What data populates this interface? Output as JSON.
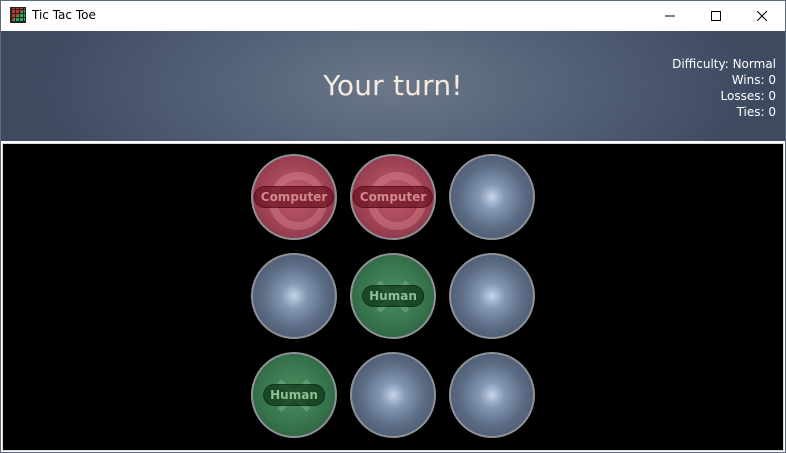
{
  "window": {
    "title": "Tic Tac Toe"
  },
  "header": {
    "turn_message": "Your turn!",
    "stats": {
      "difficulty": "Difficulty: Normal",
      "wins": "Wins: 0",
      "losses": "Losses: 0",
      "ties": "Ties: 0"
    }
  },
  "board": {
    "owner_labels": {
      "computer": "Computer",
      "human": "Human"
    },
    "cells": [
      {
        "state": "computer",
        "label": "Computer"
      },
      {
        "state": "computer",
        "label": "Computer"
      },
      {
        "state": "empty",
        "label": ""
      },
      {
        "state": "empty",
        "label": ""
      },
      {
        "state": "human",
        "label": "Human"
      },
      {
        "state": "empty",
        "label": ""
      },
      {
        "state": "human",
        "label": "Human"
      },
      {
        "state": "empty",
        "label": ""
      },
      {
        "state": "empty",
        "label": ""
      }
    ]
  },
  "colors": {
    "computer": "#a8475a",
    "human": "#3b7a50",
    "empty": "#5b6b84",
    "header_text": "#f6eadf"
  },
  "icons": {
    "app": "tic-tac-toe-grid-icon",
    "minimize": "minimize-icon",
    "maximize": "maximize-icon",
    "close": "close-icon"
  }
}
